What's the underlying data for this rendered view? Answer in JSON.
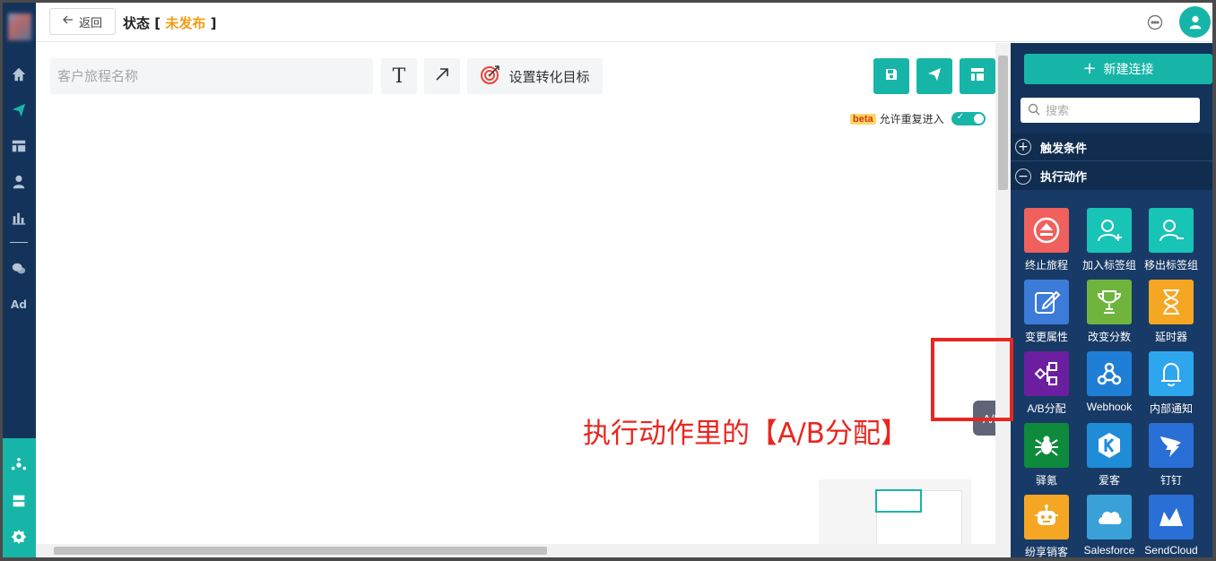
{
  "header": {
    "back_label": "返回",
    "status_label": "状态",
    "status_value": "未发布",
    "bracket_open": "[",
    "bracket_close": "]"
  },
  "toolbar": {
    "name_placeholder": "客户旅程名称",
    "text_tool": "T",
    "goal_label": "设置转化目标",
    "beta_badge": "beta",
    "repeat_label": "允许重复进入",
    "repeat_enabled": true
  },
  "panel": {
    "new_connection": "新建连接",
    "search_placeholder": "搜索",
    "sections": [
      {
        "label": "触发条件",
        "expanded": false
      },
      {
        "label": "执行动作",
        "expanded": true
      }
    ],
    "tiles": [
      {
        "label": "终止旅程",
        "icon": "eject-icon",
        "color": "#f0605d"
      },
      {
        "label": "加入标签组",
        "icon": "user-plus-icon",
        "color": "#17c4b6"
      },
      {
        "label": "移出标签组",
        "icon": "user-minus-icon",
        "color": "#17c4b6"
      },
      {
        "label": "变更属性",
        "icon": "edit-icon",
        "color": "#3d7bd8"
      },
      {
        "label": "改变分数",
        "icon": "trophy-icon",
        "color": "#6fb53d"
      },
      {
        "label": "延时器",
        "icon": "hourglass-icon",
        "color": "#f5a623"
      },
      {
        "label": "A/B分配",
        "icon": "ab-split-icon",
        "color": "#6b1fa0"
      },
      {
        "label": "Webhook",
        "icon": "webhook-icon",
        "color": "#1f7fd6"
      },
      {
        "label": "内部通知",
        "icon": "bell-icon",
        "color": "#2ea6ee"
      },
      {
        "label": "驿氪",
        "icon": "spider-icon",
        "color": "#0e8a3c"
      },
      {
        "label": "爱客",
        "icon": "k-icon",
        "color": "#1f8cd8"
      },
      {
        "label": "钉钉",
        "icon": "dingtalk-icon",
        "color": "#2a6fd6"
      },
      {
        "label": "纷享销客",
        "icon": "robot-icon",
        "color": "#f5a623"
      },
      {
        "label": "Salesforce",
        "icon": "cloud-icon",
        "color": "#3aa0d8"
      },
      {
        "label": "SendCloud",
        "icon": "sendcloud-icon",
        "color": "#2a6fd6"
      }
    ]
  },
  "tooltip": "A/B分配",
  "annotation": "执行动作里的【A/B分配】",
  "colors": {
    "accent": "#17b5a8",
    "nav_bg": "#13335a",
    "status_warning": "#f39c12",
    "annotation": "#e8261f"
  }
}
